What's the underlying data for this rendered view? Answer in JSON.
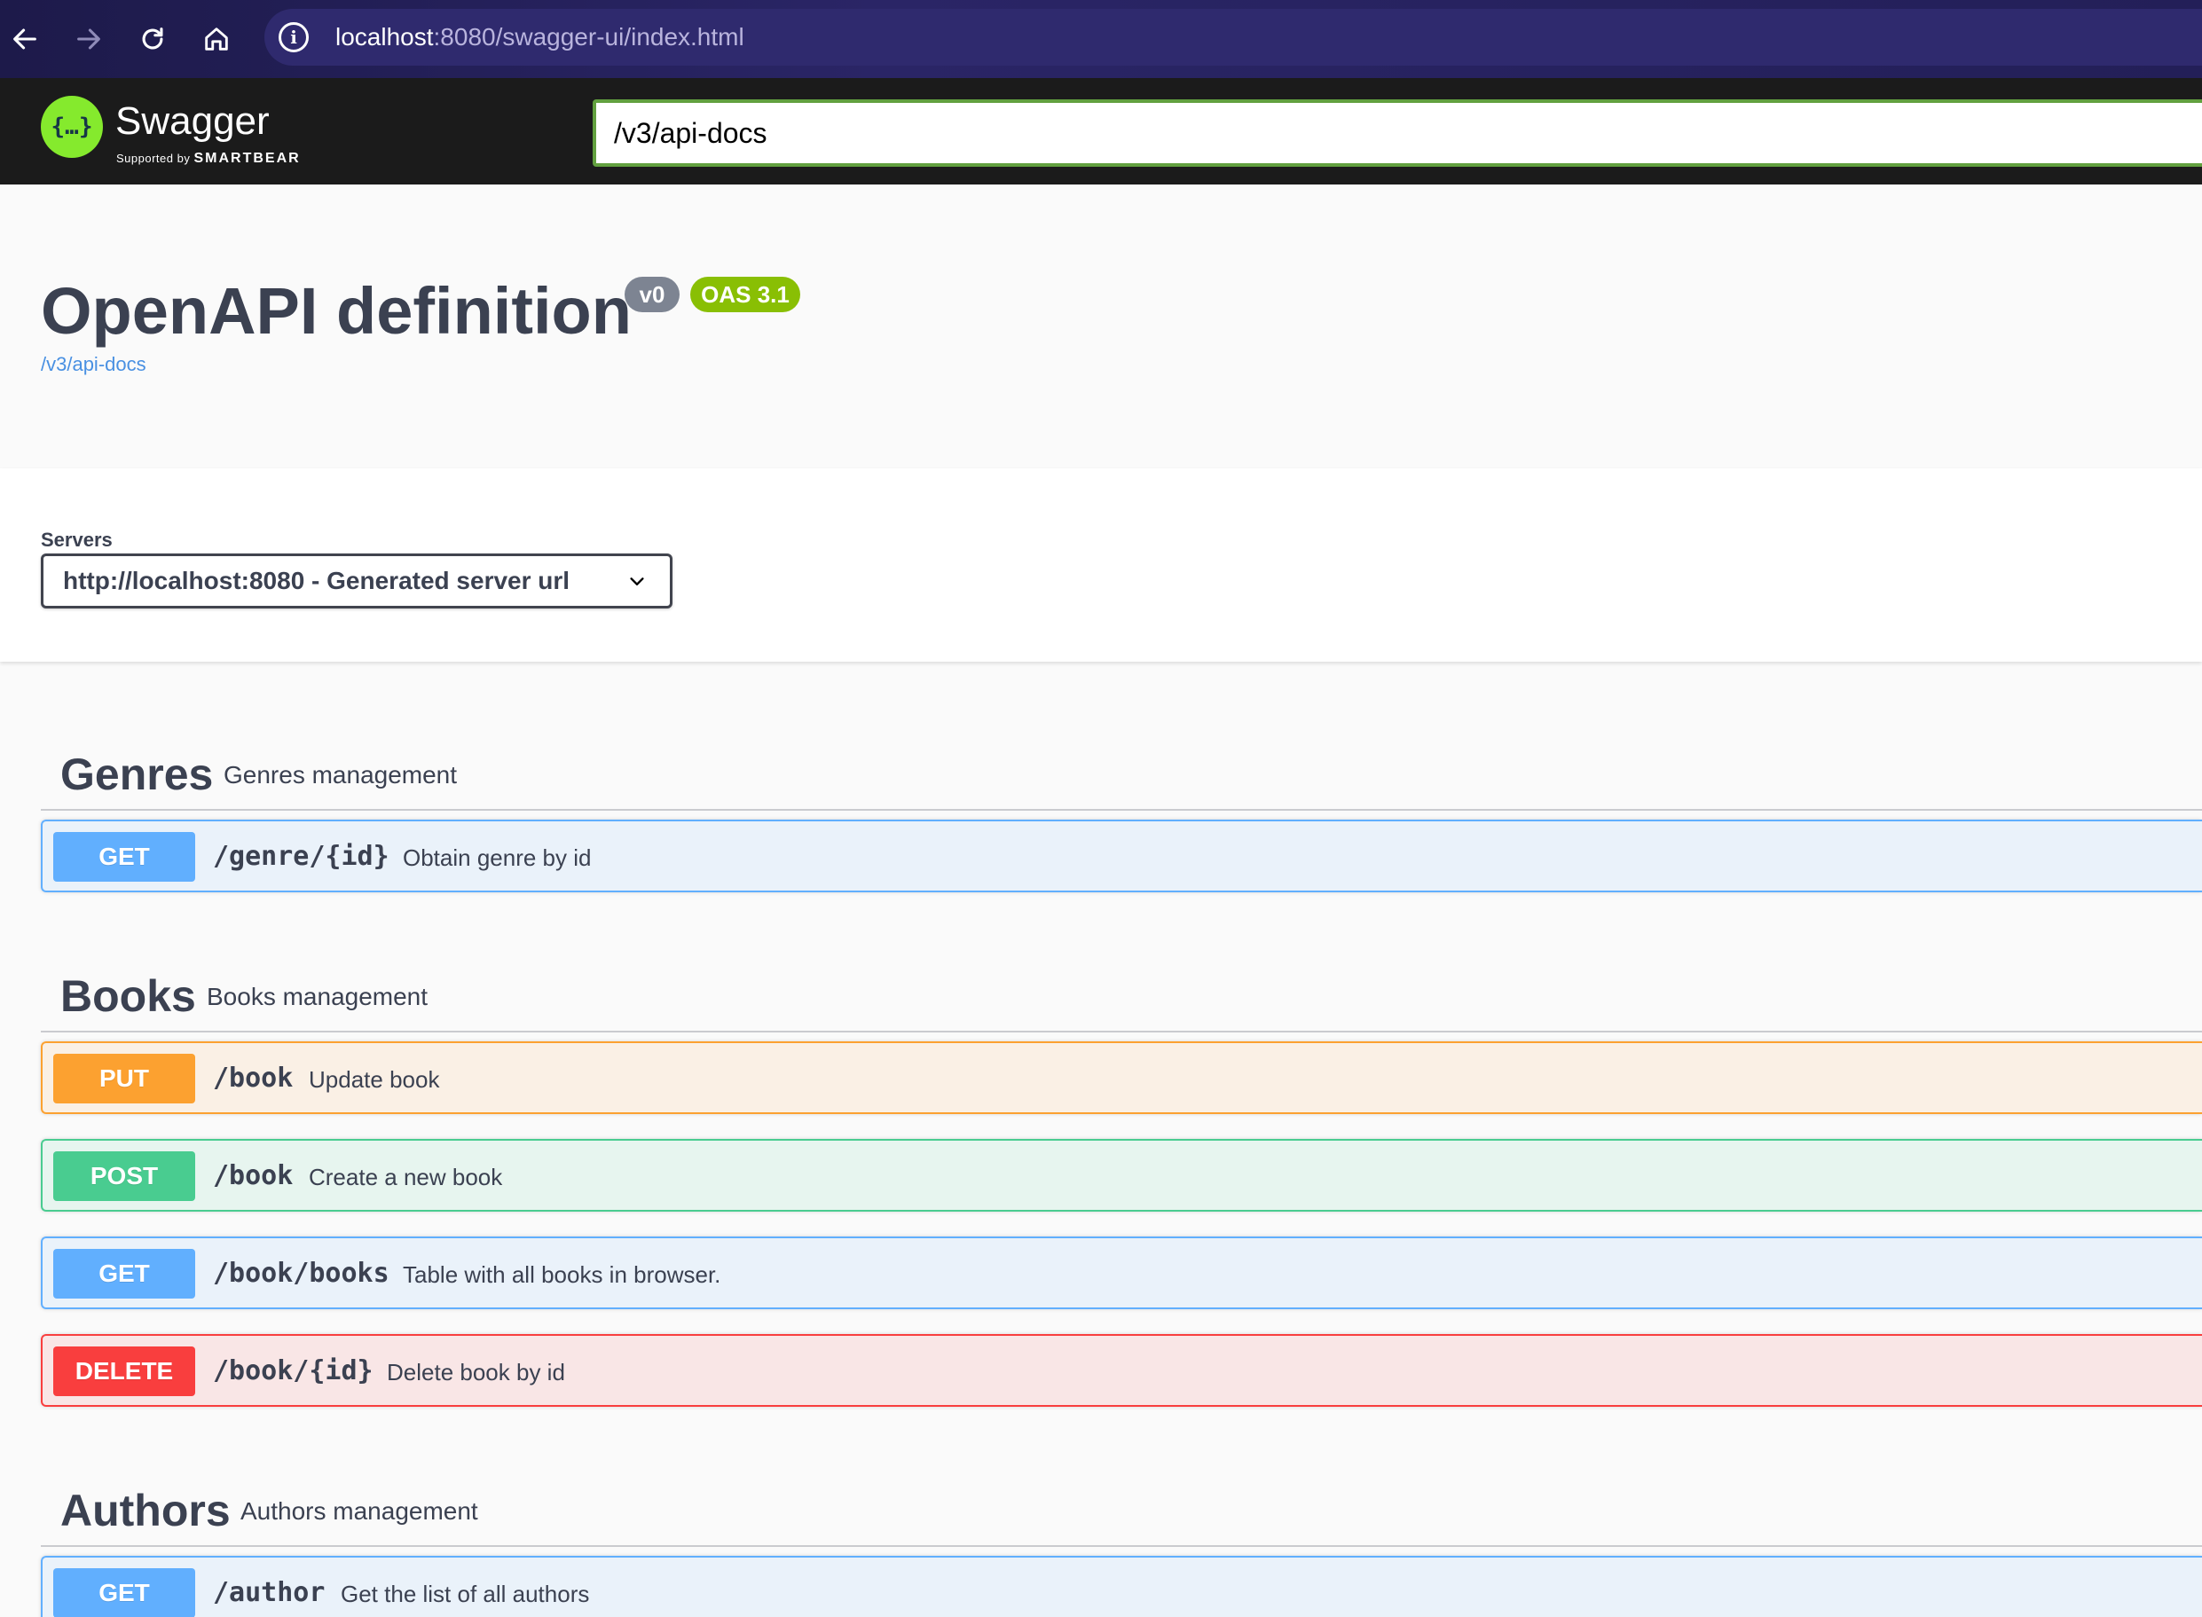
{
  "browser": {
    "url_host": "localhost",
    "url_rest": ":8080/swagger-ui/index.html",
    "info_glyph": "i"
  },
  "topbar": {
    "logo_glyph": "{…}",
    "logo_text": "Swagger",
    "logo_sub_prefix": "Supported by",
    "logo_sub_brand": "SMARTBEAR",
    "spec_url_value": "/v3/api-docs"
  },
  "info": {
    "title": "OpenAPI definition",
    "version": "v0",
    "oas": "OAS 3.1",
    "spec_link": "/v3/api-docs"
  },
  "servers": {
    "label": "Servers",
    "selected": "http://localhost:8080 - Generated server url"
  },
  "tags": [
    {
      "name": "Genres",
      "description": "Genres management",
      "operations": [
        {
          "method": "GET",
          "path": "/genre/{id}",
          "summary": "Obtain genre by id"
        }
      ]
    },
    {
      "name": "Books",
      "description": "Books management",
      "operations": [
        {
          "method": "PUT",
          "path": "/book",
          "summary": "Update book"
        },
        {
          "method": "POST",
          "path": "/book",
          "summary": "Create a new book"
        },
        {
          "method": "GET",
          "path": "/book/books",
          "summary": "Table with all books in browser."
        },
        {
          "method": "DELETE",
          "path": "/book/{id}",
          "summary": "Delete book by id"
        }
      ]
    },
    {
      "name": "Authors",
      "description": "Authors management",
      "operations": [
        {
          "method": "GET",
          "path": "/author",
          "summary": "Get the list of all authors"
        }
      ]
    }
  ],
  "colors": {
    "get": "#61affe",
    "put": "#fca130",
    "post": "#49cc90",
    "delete": "#f93e3e",
    "topbar": "#1b1b1b",
    "logo": "#85ea2d"
  }
}
